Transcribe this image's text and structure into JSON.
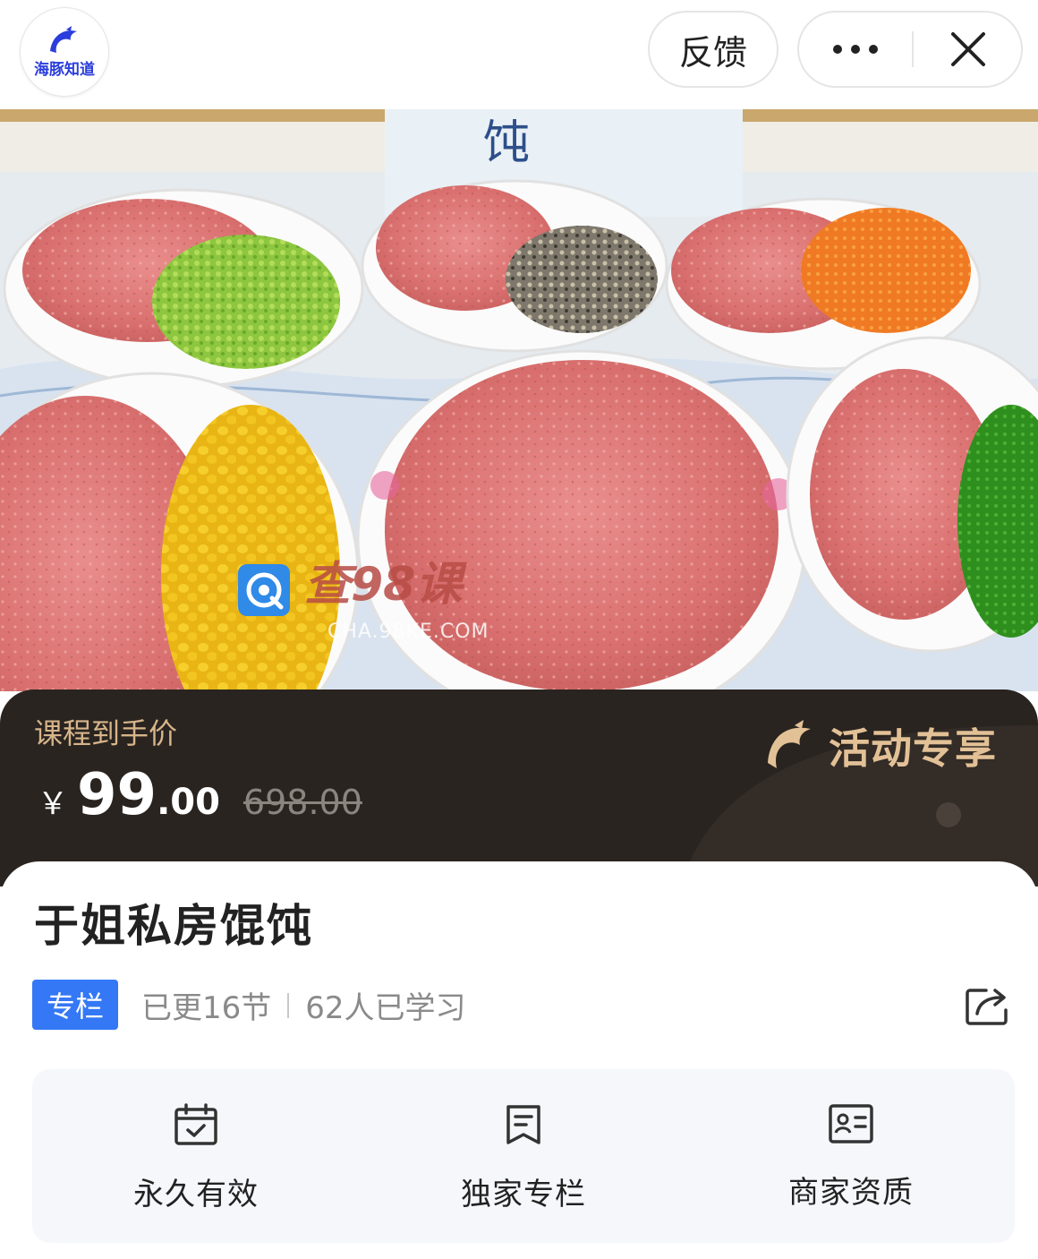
{
  "header": {
    "logo_text": "海豚知道",
    "feedback_label": "反馈",
    "more_icon": "more-dots-icon",
    "close_icon": "close-icon"
  },
  "hero": {
    "watermark_cn": "查98课",
    "watermark_url": "CHA.98KE.COM",
    "sign_text": "饨"
  },
  "price": {
    "label": "课程到手价",
    "currency": "￥",
    "current_int": "99",
    "current_dec": ".00",
    "original": "698.00",
    "promo_text": "活动专享"
  },
  "course": {
    "title": "于姐私房馄饨",
    "tag": "专栏",
    "updated": "已更16节",
    "learners": "62人已学习"
  },
  "features": [
    {
      "label": "永久有效",
      "icon": "calendar-check-icon"
    },
    {
      "label": "独家专栏",
      "icon": "bookmark-doc-icon"
    },
    {
      "label": "商家资质",
      "icon": "id-card-icon"
    }
  ],
  "colors": {
    "accent_blue": "#3478f6",
    "price_band": "#2a2420",
    "gold": "#d7b58a"
  }
}
